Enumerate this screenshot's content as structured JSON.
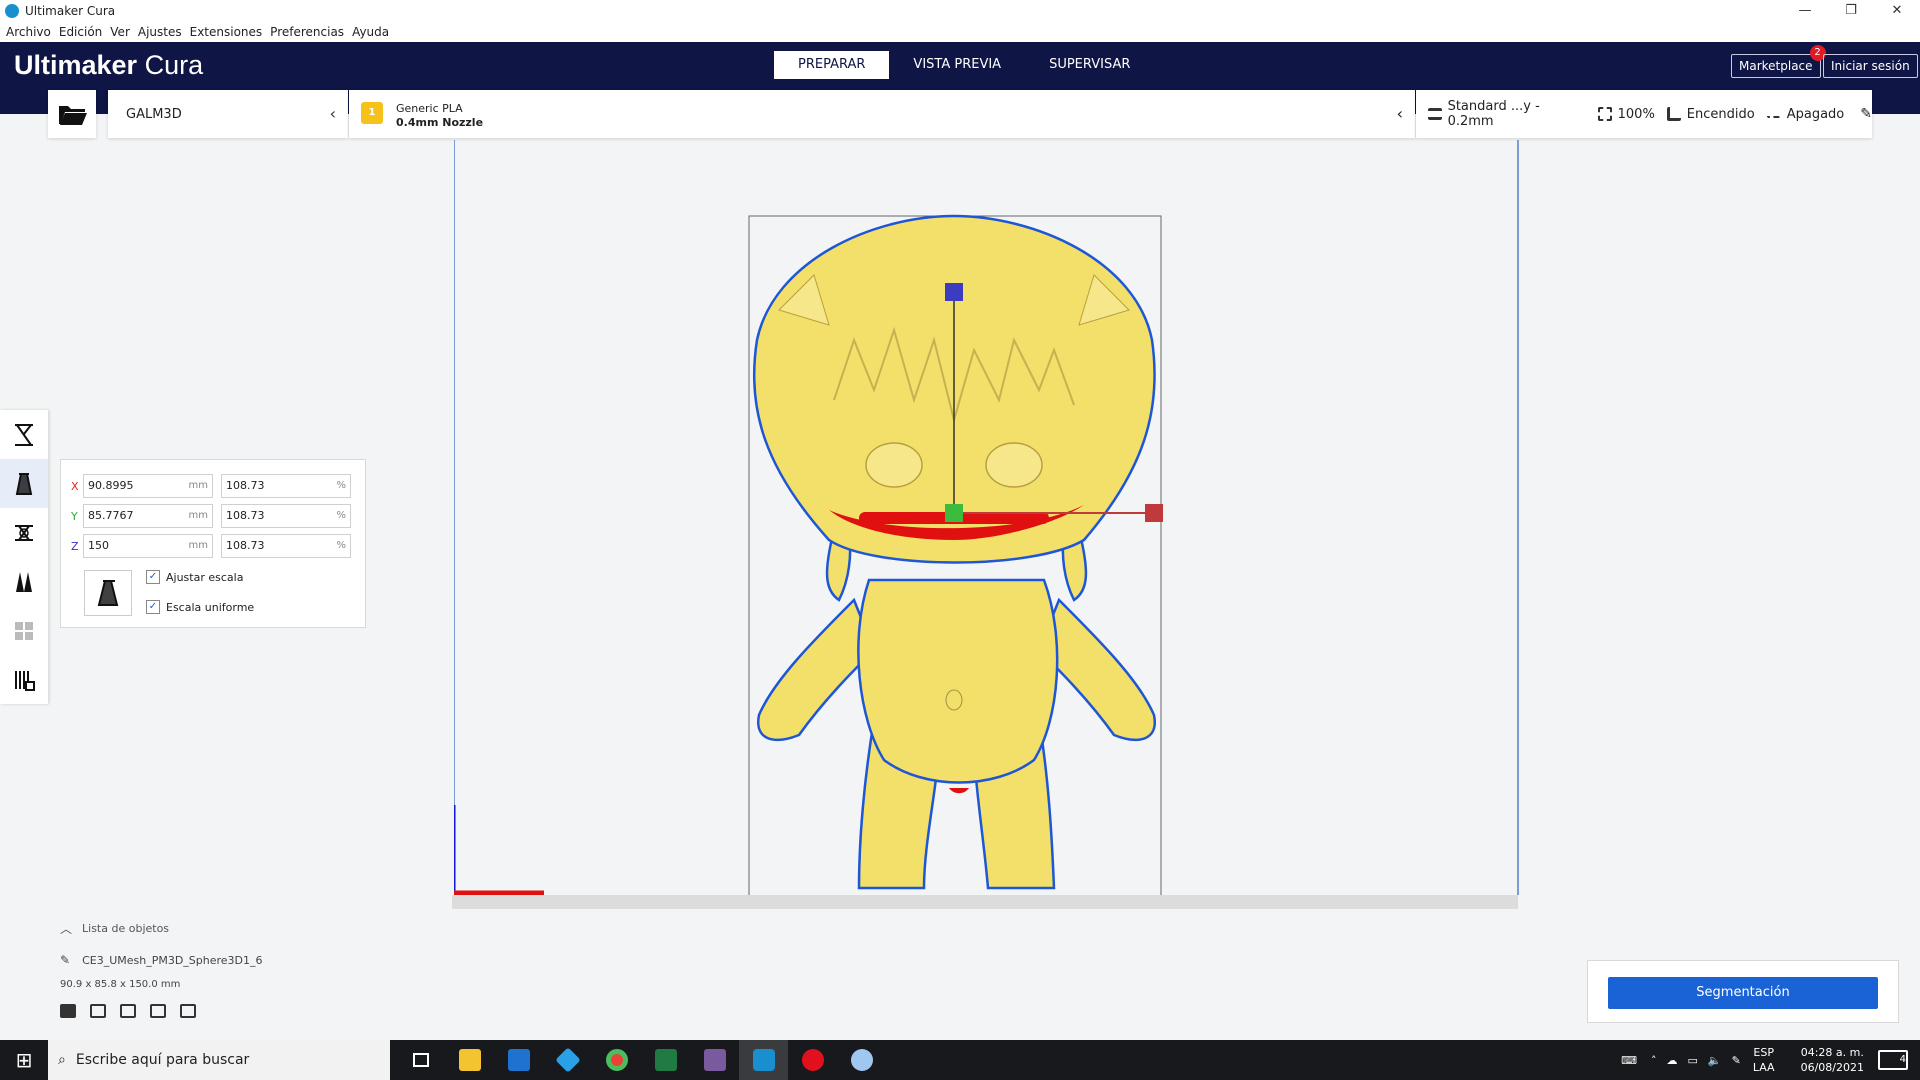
{
  "window": {
    "title": "Ultimaker Cura",
    "controls": [
      "—",
      "❐",
      "✕"
    ]
  },
  "menu": [
    "Archivo",
    "Edición",
    "Ver",
    "Ajustes",
    "Extensiones",
    "Preferencias",
    "Ayuda"
  ],
  "header": {
    "brand_bold": "Ultimaker",
    "brand_light": " Cura",
    "tabs": [
      "PREPARAR",
      "VISTA PREVIA",
      "SUPERVISAR"
    ],
    "active_tab": "PREPARAR",
    "marketplace": "Marketplace",
    "marketplace_badge": "2",
    "login": "Iniciar sesión"
  },
  "printer": {
    "name": "GALM3D"
  },
  "material": {
    "slot": "1",
    "name": "Generic PLA",
    "nozzle": "0.4mm Nozzle"
  },
  "profile": {
    "name": "Standard ...y - 0.2mm",
    "infill": "100%",
    "support": "Encendido",
    "adhesion": "Apagado"
  },
  "scale_panel": {
    "x": {
      "axis": "X",
      "mm": "90.8995",
      "pct": "108.73"
    },
    "y": {
      "axis": "Y",
      "mm": "85.7767",
      "pct": "108.73"
    },
    "z": {
      "axis": "Z",
      "mm": "150",
      "pct": "108.73"
    },
    "unit_mm": "mm",
    "unit_pct": "%",
    "snap_label": "Ajustar escala",
    "uniform_label": "Escala uniforme"
  },
  "object_list": {
    "header": "Lista de objetos",
    "object_name": "CE3_UMesh_PM3D_Sphere3D1_6",
    "dimensions": "90.9 x 85.8 x 150.0 mm"
  },
  "slice_button": "Segmentación",
  "taskbar": {
    "search_placeholder": "Escribe aquí para buscar",
    "lang_1": "ESP",
    "lang_2": "LAA",
    "time": "04:28 a. m.",
    "date": "06/08/2021",
    "notifications": "4"
  },
  "colors": {
    "brand_navy": "#0f1544",
    "accent_blue": "#1a63d6",
    "model_yellow": "#f2e06a"
  }
}
